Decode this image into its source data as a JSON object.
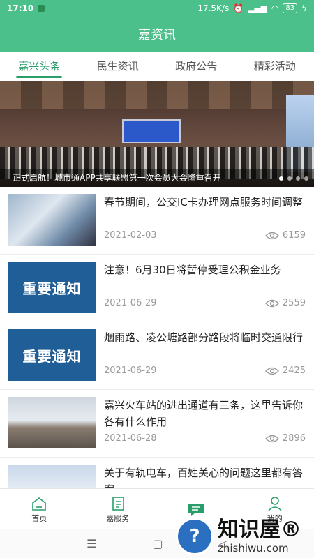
{
  "status": {
    "time": "17:10",
    "speed": "17.5K/s",
    "battery": "83"
  },
  "header": {
    "title": "嘉资讯"
  },
  "tabs": [
    {
      "label": "嘉兴头条",
      "active": true
    },
    {
      "label": "民生资讯"
    },
    {
      "label": "政府公告"
    },
    {
      "label": "精彩活动"
    }
  ],
  "banner": {
    "caption": "正式启航！城市通APP共享联盟第一次会员大会隆重召开",
    "dot_count": 4,
    "active_dot": 0
  },
  "news": [
    {
      "title": "春节期间，公交IC卡办理网点服务时间调整",
      "date": "2021-02-03",
      "views": "6159"
    },
    {
      "title": "注意！6月30日将暂停受理公积金业务",
      "date": "2021-06-29",
      "views": "2559",
      "thumb_text": "重要通知"
    },
    {
      "title": "烟雨路、凌公塘路部分路段将临时交通限行",
      "date": "2021-06-29",
      "views": "2425",
      "thumb_text": "重要通知"
    },
    {
      "title": "嘉兴火车站的进出通道有三条，这里告诉你各有什么作用",
      "date": "2021-06-28",
      "views": "2896"
    },
    {
      "title": "关于有轨电车，百姓关心的问题这里都有答案"
    }
  ],
  "bottom_nav": [
    {
      "label": "首页",
      "icon": "home-icon"
    },
    {
      "label": "嘉服务",
      "icon": "service-icon"
    },
    {
      "label": "",
      "icon": "message-icon"
    },
    {
      "label": "我的",
      "icon": "user-icon"
    }
  ],
  "watermark": {
    "title": "知识屋®",
    "subtitle": "zhishiwu.com"
  },
  "colors": {
    "brand": "#4cc08a",
    "tab_active": "#2a9e6a",
    "notice_blue": "#1f5e96"
  }
}
